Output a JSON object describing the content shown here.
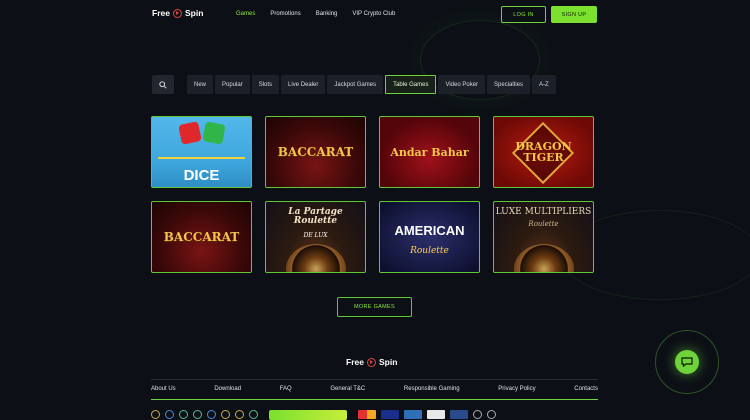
{
  "header": {
    "logo_left": "Free",
    "logo_right": "Spin",
    "nav": [
      "Games",
      "Promotions",
      "Banking",
      "VIP Crypto Club"
    ],
    "active_nav": "Games",
    "login_label": "LOG IN",
    "signup_label": "SIGN UP"
  },
  "filters": {
    "tabs": [
      "New",
      "Popular",
      "Slots",
      "Live Dealer",
      "Jackpot Games",
      "Table Games",
      "Video Poker",
      "Specialties",
      "A-Z"
    ],
    "active_tab": "Table Games"
  },
  "games": [
    {
      "title": "DICE"
    },
    {
      "title": "BACCARAT"
    },
    {
      "title": "Andar Bahar"
    },
    {
      "title": "DRAGON TIGER"
    },
    {
      "title": "BACCARAT"
    },
    {
      "title": "La Partage Roulette",
      "sub": "DE LUX"
    },
    {
      "title": "AMERICAN",
      "sub": "Roulette"
    },
    {
      "title": "LUXE MULTIPLIERS",
      "sub": "Roulette"
    }
  ],
  "more_games_label": "MORE GAMES",
  "footer": {
    "logo_left": "Free",
    "logo_right": "Spin",
    "links": [
      "About Us",
      "Download",
      "FAQ",
      "General T&C",
      "Responsible Gaming",
      "Privacy Policy",
      "Contacts"
    ]
  },
  "colors": {
    "accent": "#7be02e",
    "background": "#0c1016"
  },
  "icons": {
    "search": "search-icon",
    "chat": "chat-icon"
  }
}
